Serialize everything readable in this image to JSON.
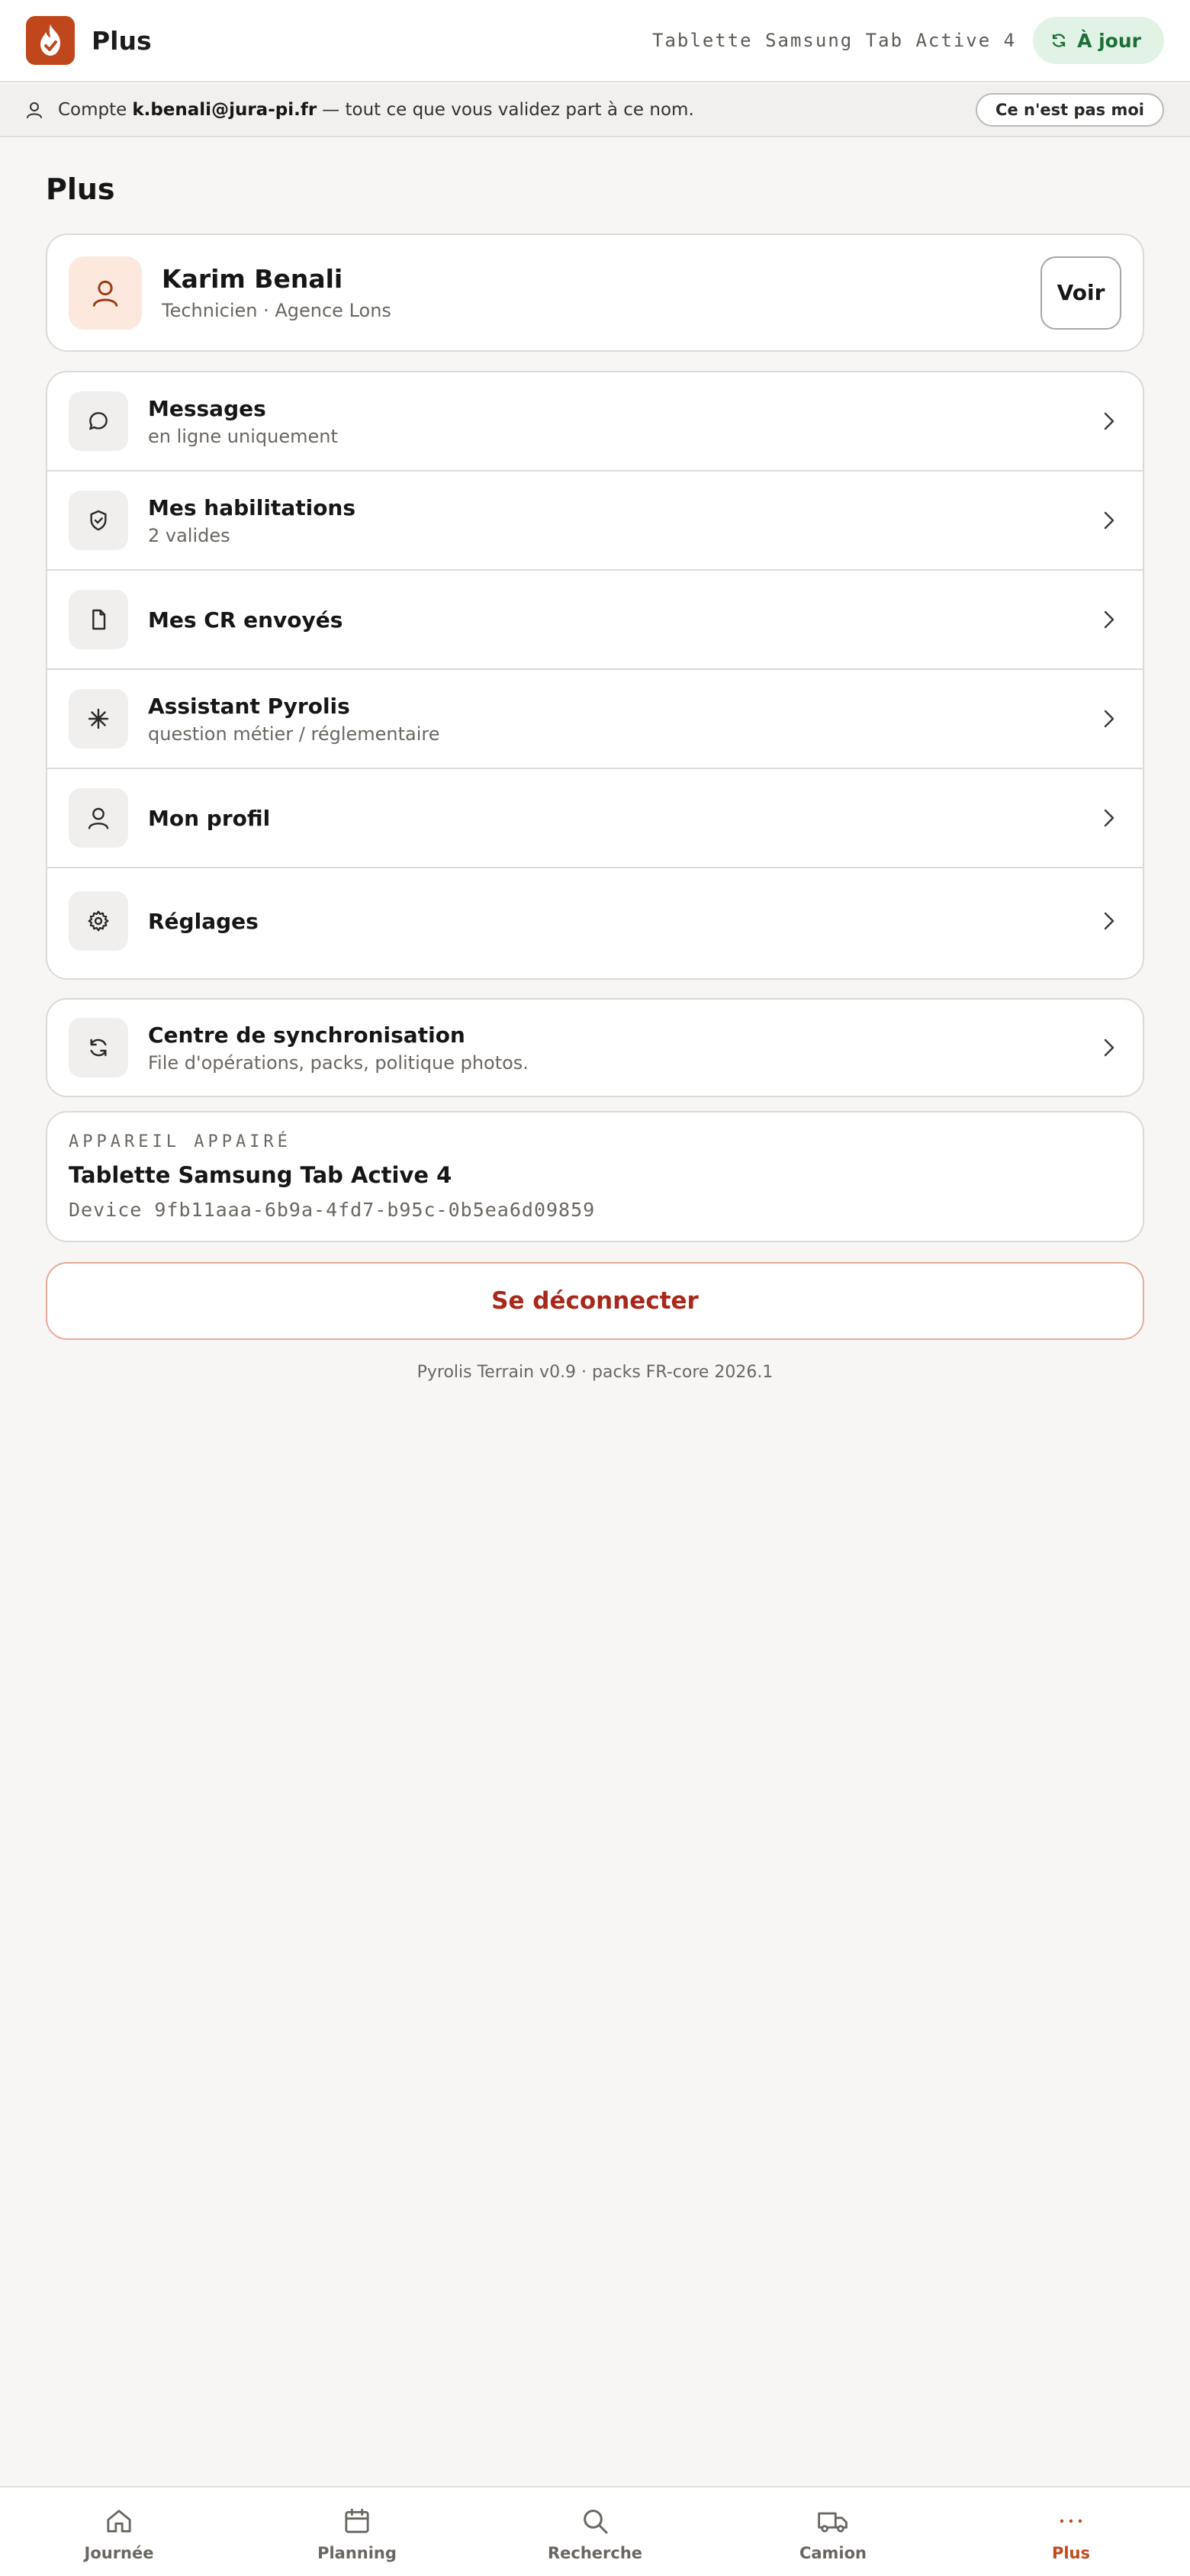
{
  "header": {
    "title": "Plus",
    "device_name": "Tablette Samsung Tab Active 4",
    "sync_status": "À jour",
    "brand_color": "#c0471c"
  },
  "account_banner": {
    "prefix": "Compte",
    "email": "k.benali@jura-pi.fr",
    "suffix": "— tout ce que vous validez part à ce nom.",
    "not_me_label": "Ce n'est pas moi"
  },
  "page_title": "Plus",
  "profile": {
    "name": "Karim Benali",
    "role": "Technicien · Agence Lons",
    "view_label": "Voir"
  },
  "menu": {
    "items": [
      {
        "label": "Messages",
        "sub": "en ligne uniquement",
        "icon": "message-icon"
      },
      {
        "label": "Mes habilitations",
        "sub": "2 valides",
        "icon": "shield-check-icon"
      },
      {
        "label": "Mes CR envoyés",
        "sub": "",
        "icon": "document-icon"
      },
      {
        "label": "Assistant Pyrolis",
        "sub": "question métier / réglementaire",
        "icon": "sparkle-icon"
      },
      {
        "label": "Mon profil",
        "sub": "",
        "icon": "user-icon"
      },
      {
        "label": "Réglages",
        "sub": "",
        "icon": "gear-icon"
      }
    ]
  },
  "sync_center": {
    "label": "Centre de synchronisation",
    "sub": "File d'opérations, packs, politique photos."
  },
  "device": {
    "eyebrow": "APPAREIL APPAIRÉ",
    "name": "Tablette Samsung Tab Active 4",
    "id": "Device 9fb11aaa-6b9a-4fd7-b95c-0b5ea6d09859"
  },
  "logout_label": "Se déconnecter",
  "version": "Pyrolis Terrain v0.9 · packs FR-core 2026.1",
  "bottom_nav": {
    "items": [
      {
        "label": "Journée"
      },
      {
        "label": "Planning"
      },
      {
        "label": "Recherche"
      },
      {
        "label": "Camion"
      },
      {
        "label": "Plus"
      }
    ],
    "active_color": "#bf4a1c"
  }
}
